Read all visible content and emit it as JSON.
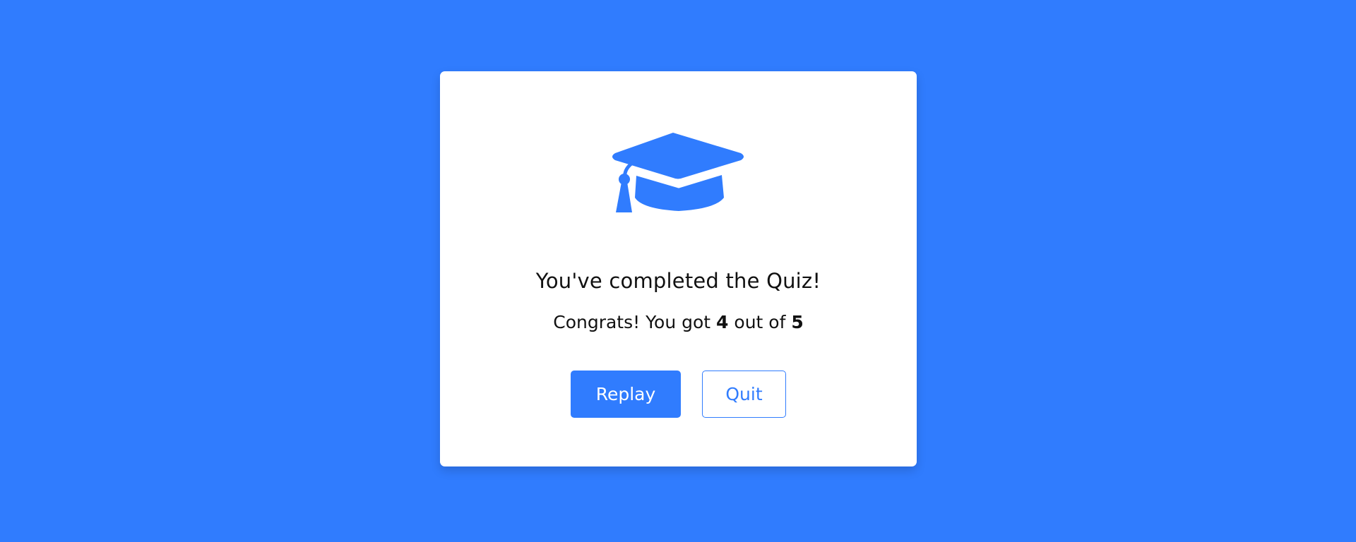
{
  "result": {
    "icon": "graduation-cap-icon",
    "complete_text": "You've completed the Quiz!",
    "score": {
      "prefix": "Congrats! You got ",
      "correct": "4",
      "middle": " out of ",
      "total": "5"
    }
  },
  "buttons": {
    "replay_label": "Replay",
    "quit_label": "Quit"
  },
  "colors": {
    "background": "#307cfe",
    "accent": "#307cfe",
    "card": "#ffffff"
  }
}
